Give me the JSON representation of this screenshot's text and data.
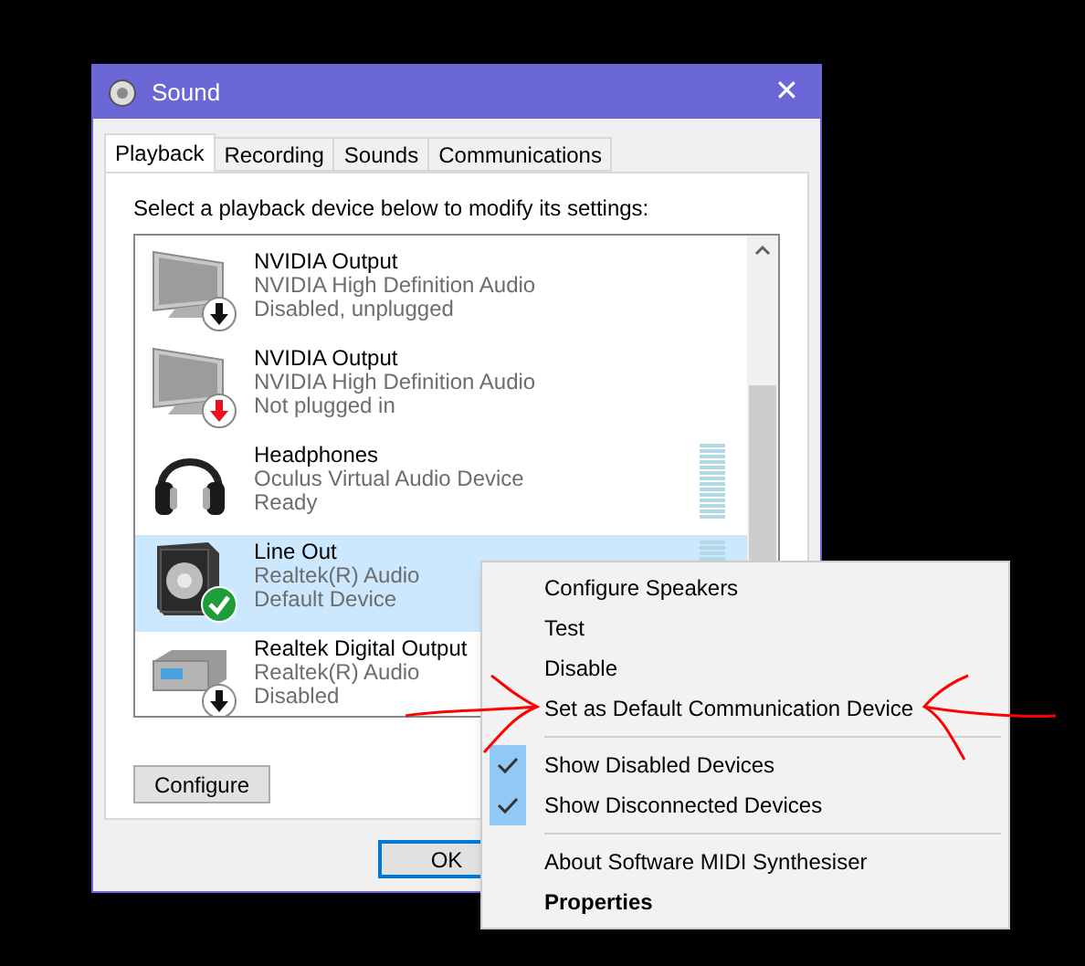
{
  "window": {
    "title": "Sound",
    "close": "✕"
  },
  "tabs": [
    {
      "label": "Playback",
      "selected": true
    },
    {
      "label": "Recording",
      "selected": false
    },
    {
      "label": "Sounds",
      "selected": false
    },
    {
      "label": "Communications",
      "selected": false
    }
  ],
  "instruction": "Select a playback device below to modify its settings:",
  "devices": [
    {
      "name": "NVIDIA Output",
      "driver": "NVIDIA High Definition Audio",
      "status": "Disabled, unplugged",
      "kind": "monitor",
      "overlay": {
        "kind": "down"
      },
      "selected": false,
      "meter": false
    },
    {
      "name": "NVIDIA Output",
      "driver": "NVIDIA High Definition Audio",
      "status": "Not plugged in",
      "kind": "monitor",
      "overlay": {
        "kind": "unplugged"
      },
      "selected": false,
      "meter": false
    },
    {
      "name": "Headphones",
      "driver": "Oculus Virtual Audio Device",
      "status": "Ready",
      "kind": "headphones",
      "selected": false,
      "meter": true
    },
    {
      "name": "Line Out",
      "driver": "Realtek(R) Audio",
      "status": "Default Device",
      "kind": "speaker",
      "overlay": {
        "kind": "default"
      },
      "selected": true,
      "meter": true
    },
    {
      "name": "Realtek Digital Output",
      "driver": "Realtek(R) Audio",
      "status": "Disabled",
      "kind": "receiver",
      "overlay": {
        "kind": "down"
      },
      "selected": false,
      "meter": false
    }
  ],
  "buttons": {
    "configure": "Configure",
    "ok": "OK"
  },
  "context_menu": [
    {
      "kind": "item",
      "label": "Configure Speakers",
      "checked": false,
      "bold": false
    },
    {
      "kind": "item",
      "label": "Test",
      "checked": false,
      "bold": false
    },
    {
      "kind": "item",
      "label": "Disable",
      "checked": false,
      "bold": false
    },
    {
      "kind": "item",
      "label": "Set as Default Communication Device",
      "checked": false,
      "bold": false
    },
    {
      "kind": "separator"
    },
    {
      "kind": "item",
      "label": "Show Disabled Devices",
      "checked": true,
      "bold": false
    },
    {
      "kind": "item",
      "label": "Show Disconnected Devices",
      "checked": true,
      "bold": false
    },
    {
      "kind": "separator"
    },
    {
      "kind": "item",
      "label": "About Software MIDI Synthesiser",
      "checked": false,
      "bold": false
    },
    {
      "kind": "item",
      "label": "Properties",
      "checked": false,
      "bold": true
    }
  ]
}
